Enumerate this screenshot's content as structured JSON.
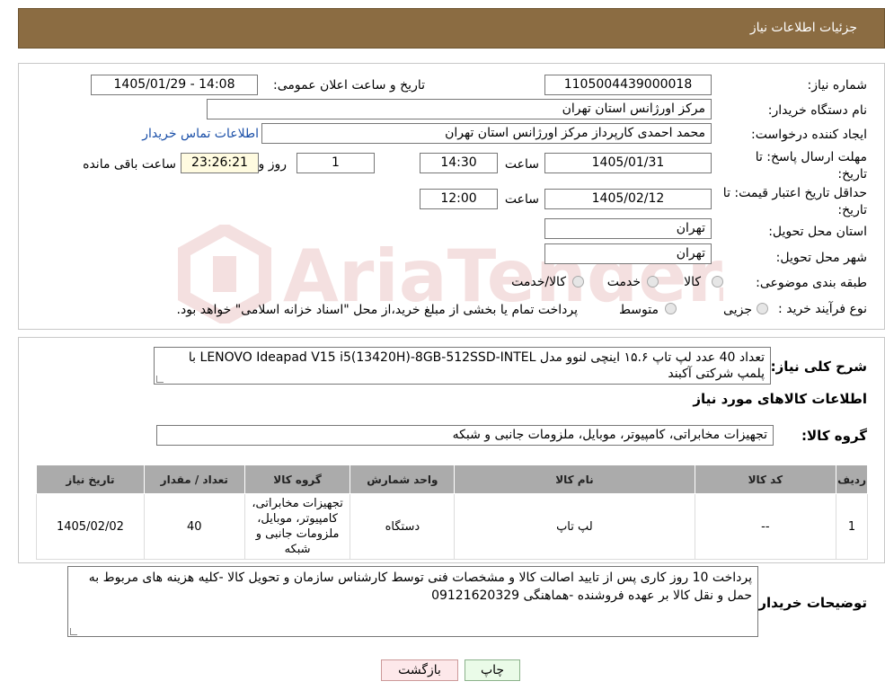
{
  "header": {
    "title": "جزئیات اطلاعات نیاز"
  },
  "watermark": {
    "text": "AriaTender.neT"
  },
  "form": {
    "need_number": {
      "label": "شماره نیاز:",
      "value": "1105004439000018"
    },
    "announce_datetime": {
      "label": "تاریخ و ساعت اعلان عمومی:",
      "value": "1405/01/29 - 14:08"
    },
    "buyer_org": {
      "label": "نام دستگاه خریدار:",
      "value": "مرکز اورژانس استان تهران"
    },
    "requester": {
      "label": "ایجاد کننده درخواست:",
      "value": "محمد احمدی کارپرداز مرکز اورژانس استان تهران",
      "contact_link": "اطلاعات تماس خریدار"
    },
    "deadline": {
      "label": "مهلت ارسال پاسخ: تا تاریخ:",
      "date": "1405/01/31",
      "time_label": "ساعت",
      "time": "14:30",
      "days": "1",
      "days_label": "روز و",
      "remaining": "23:26:21",
      "remaining_label": "ساعت باقی مانده"
    },
    "price_validity": {
      "label": "حداقل تاریخ اعتبار قیمت: تا تاریخ:",
      "date": "1405/02/12",
      "time_label": "ساعت",
      "time": "12:00"
    },
    "delivery_province": {
      "label": "استان محل تحویل:",
      "value": "تهران"
    },
    "delivery_city": {
      "label": "شهر محل تحویل:",
      "value": "تهران"
    },
    "category": {
      "label": "طبقه بندی موضوعی:",
      "options": [
        "کالا",
        "خدمت",
        "کالا/خدمت"
      ]
    },
    "purchase_type": {
      "label": "نوع فرآیند خرید :",
      "options": [
        "جزیی",
        "متوسط"
      ],
      "note": "پرداخت تمام یا بخشی از مبلغ خرید،از محل \"اسناد خزانه اسلامی\" خواهد بود."
    }
  },
  "summary": {
    "label": "شرح کلی نیاز:",
    "text": "تعداد 40 عدد لپ تاپ ۱۵.۶ اینچی لنوو مدل LENOVO Ideapad V15 i5(13420H)-8GB-512SSD-INTEL  با پلمپ شرکتی آکبند",
    "items_heading": "اطلاعات کالاهای مورد نیاز",
    "group_label": "گروه کالا:",
    "group_value": "تجهیزات مخابراتی، کامپیوتر، موبایل، ملزومات جانبی و شبکه"
  },
  "table": {
    "headers": [
      "ردیف",
      "کد کالا",
      "نام کالا",
      "واحد شمارش",
      "گروه کالا",
      "تعداد / مقدار",
      "تاریخ نیاز"
    ],
    "rows": [
      {
        "row": "1",
        "code": "--",
        "name": "لپ تاپ",
        "unit": "دستگاه",
        "group": "تجهیزات مخابراتی، کامپیوتر، موبایل، ملزومات جانبی و شبکه",
        "qty": "40",
        "date": "1405/02/02"
      }
    ]
  },
  "buyer_notes": {
    "label": "توضیحات خریدار:",
    "text": "پرداخت 10 روز کاری پس از تایید اصالت کالا و مشخصات فنی  توسط کارشناس سازمان و تحویل کالا -کلیه هزینه های مربوط به حمل و نقل کالا بر عهده فروشنده -هماهنگی 09121620329"
  },
  "buttons": {
    "print": "چاپ",
    "back": "بازگشت"
  }
}
